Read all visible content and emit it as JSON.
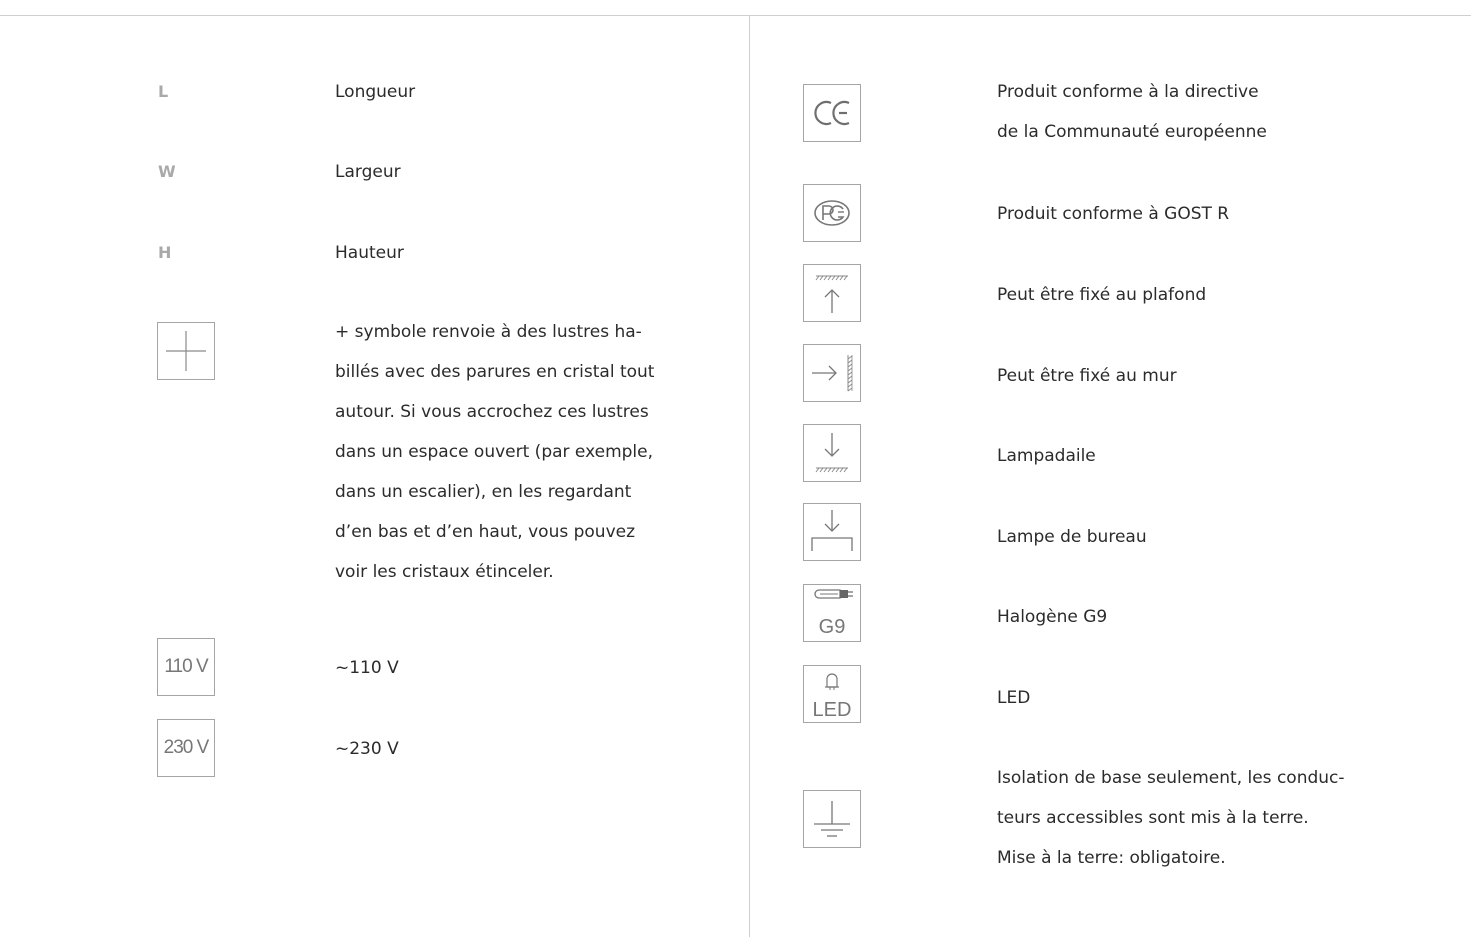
{
  "dimensions": [
    {
      "abbr": "L",
      "label": "Longueur"
    },
    {
      "abbr": "W",
      "label": "Largeur"
    },
    {
      "abbr": "H",
      "label": "Hauteur"
    }
  ],
  "crystal_note": {
    "icon": "plus-icon",
    "lines": [
      "+ symbole renvoie à des lustres ha-",
      "billés avec des parures en cristal tout",
      "autour. Si vous accrochez ces lustres",
      "dans un espace ouvert (par exemple,",
      "dans un escalier), en les regardant",
      "d’en bas et d’en haut, vous pouvez",
      "voir les cristaux étinceler."
    ]
  },
  "voltages": [
    {
      "icon_text": "110 V",
      "label": "~110 V"
    },
    {
      "icon_text": "230 V",
      "label": "~230 V"
    }
  ],
  "symbols": [
    {
      "icon": "ce-mark-icon",
      "lines": [
        "Produit conforme à la directive",
        "de la Communauté européenne"
      ]
    },
    {
      "icon": "gost-r-icon",
      "lines": [
        "Produit conforme à GOST R"
      ]
    },
    {
      "icon": "ceiling-mount-icon",
      "lines": [
        "Peut être fixé au plafond"
      ]
    },
    {
      "icon": "wall-mount-icon",
      "lines": [
        "Peut être fixé au mur"
      ]
    },
    {
      "icon": "floor-lamp-icon",
      "lines": [
        "Lampadaile"
      ]
    },
    {
      "icon": "desk-lamp-icon",
      "lines": [
        "Lampe de bureau"
      ]
    },
    {
      "icon": "halogen-g9-icon",
      "icon_text": "G9",
      "lines": [
        "Halogène G9"
      ]
    },
    {
      "icon": "led-icon",
      "icon_text": "LED",
      "lines": [
        "LED"
      ]
    },
    {
      "icon": "earth-ground-icon",
      "lines": [
        "Isolation de base seulement, les conduc-",
        "teurs accessibles sont mis à la terre.",
        "Mise à la terre: obligatoire."
      ]
    }
  ]
}
